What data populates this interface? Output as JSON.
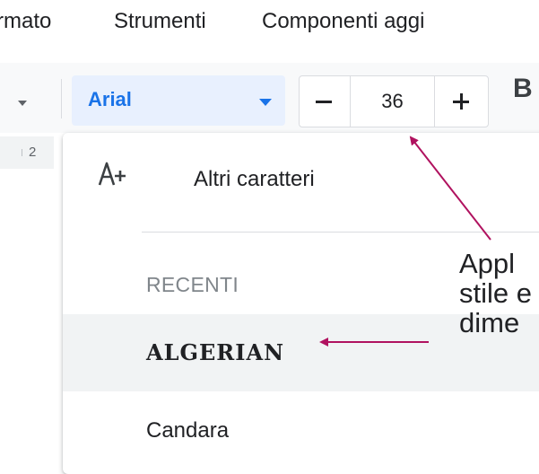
{
  "menubar": {
    "items": [
      {
        "label": "rmato"
      },
      {
        "label": "Strumenti"
      },
      {
        "label": "Componenti aggi"
      }
    ]
  },
  "toolbar": {
    "font_select": {
      "value": "Arial"
    },
    "font_size": {
      "value": "36"
    },
    "bold_label": "B"
  },
  "ruler": {
    "number": "2"
  },
  "font_menu": {
    "more_fonts_label": "Altri caratteri",
    "recent_header": "RECENTI",
    "fonts": [
      {
        "label": "ALGERIAN",
        "highlighted": true
      },
      {
        "label": "Candara",
        "highlighted": false
      }
    ]
  },
  "annotation": {
    "lines": [
      "Appl",
      "stile e",
      "dime"
    ],
    "arrow_color": "#b0125f"
  },
  "colors": {
    "accent": "#1a73e8",
    "selected_font_bg": "#e8f0fe",
    "hover_row_bg": "#f1f3f4"
  }
}
